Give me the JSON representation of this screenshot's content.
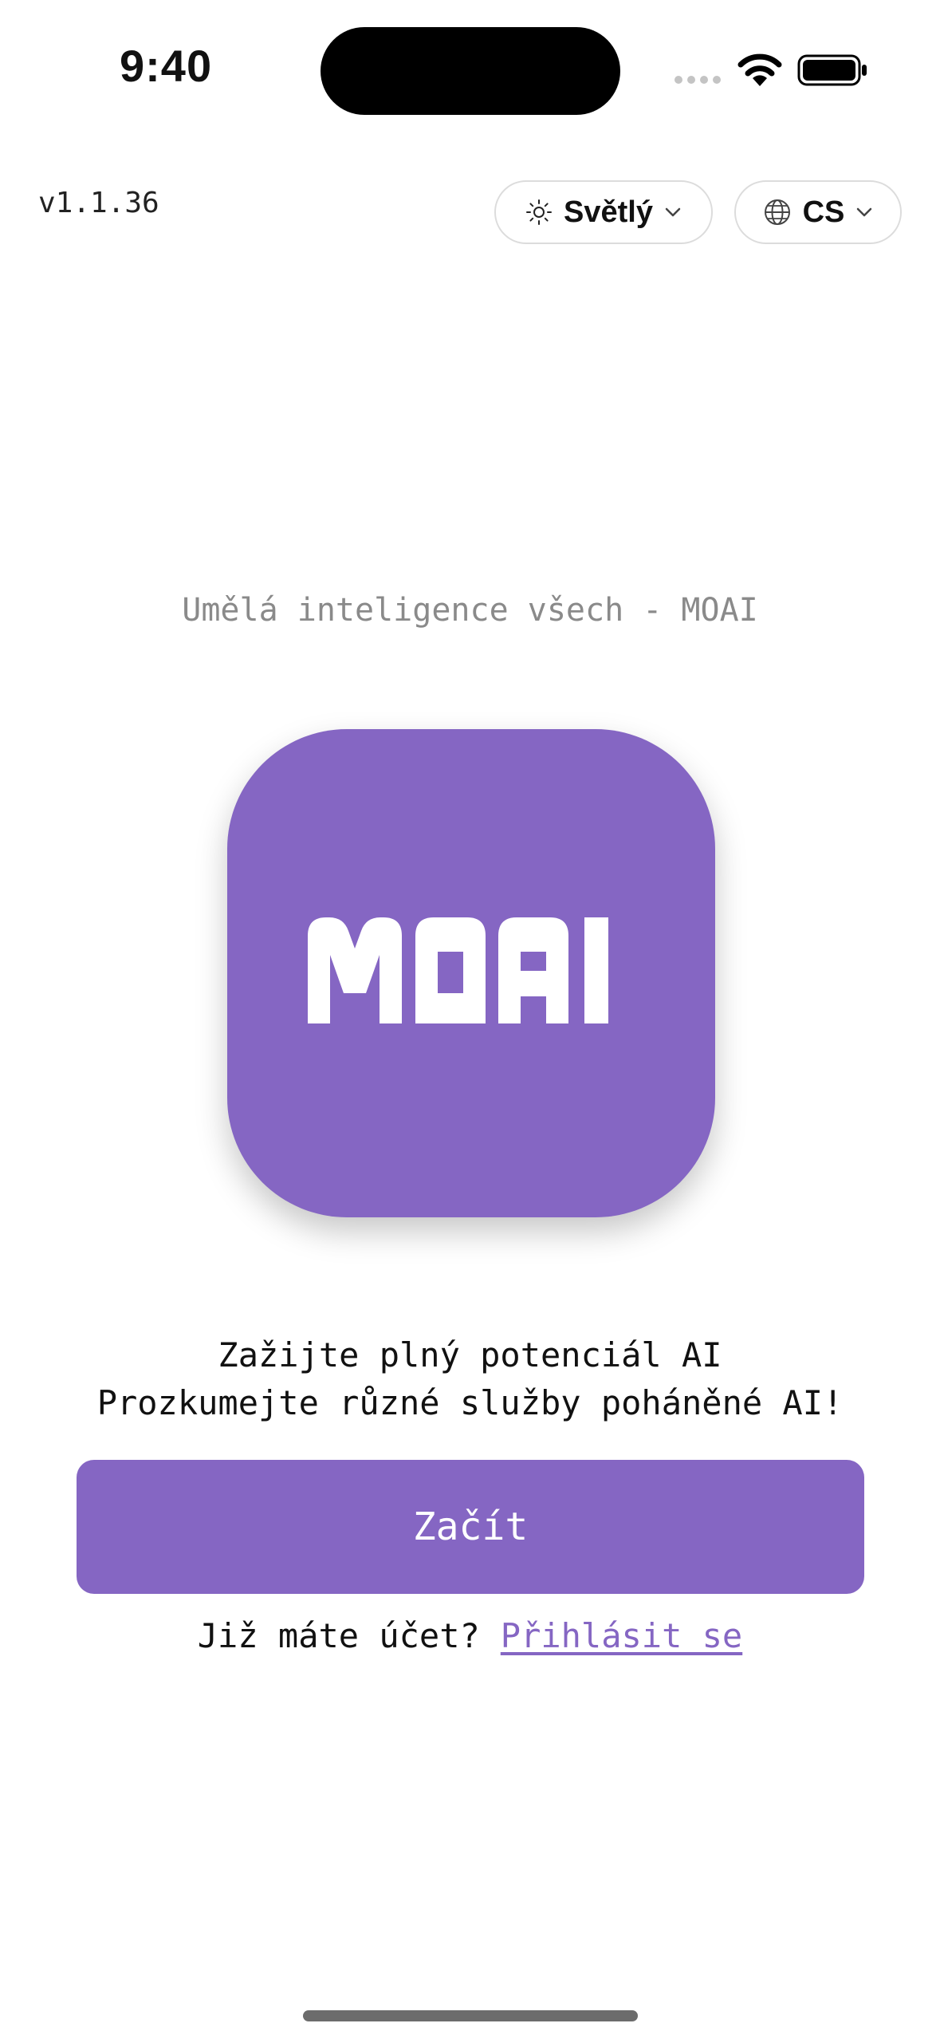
{
  "status_bar": {
    "time": "9:40"
  },
  "header": {
    "version": "v1.1.36",
    "theme_selector": {
      "label": "Světlý",
      "icon": "sun-icon"
    },
    "language_selector": {
      "label": "CS",
      "icon": "globe-icon"
    }
  },
  "main": {
    "tagline": "Umělá inteligence všech - MOAI",
    "logo_text": "MOAI",
    "subtitle_line1": "Zažijte plný potenciál AI",
    "subtitle_line2": "Prozkumejte různé služby poháněné AI!",
    "start_label": "Začít",
    "login_prompt": "Již máte účet?",
    "login_link": "Přihlásit se"
  },
  "colors": {
    "brand": "#8566c3",
    "text": "#111111",
    "muted": "#8a8a8a"
  }
}
